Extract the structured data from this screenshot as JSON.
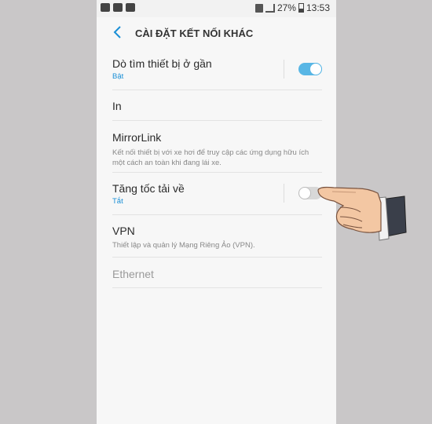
{
  "statusbar": {
    "battery": "27%",
    "time": "13:53"
  },
  "header": {
    "title": "CÀI ĐẶT KẾT NỐI KHÁC"
  },
  "items": [
    {
      "label": "Dò tìm thiết bị ở gần",
      "sub": "Bật",
      "toggle": "on"
    },
    {
      "label": "In"
    },
    {
      "label": "MirrorLink",
      "desc": "Kết nối thiết bị với xe hơi để truy cập các ứng dụng hữu ích một cách an toàn khi đang lái xe."
    },
    {
      "label": "Tăng tốc tải về",
      "sub": "Tắt",
      "toggle": "off"
    },
    {
      "label": "VPN",
      "desc": "Thiết lập và quản lý Mạng Riêng Ảo (VPN)."
    },
    {
      "label": "Ethernet",
      "disabled": true
    }
  ],
  "colors": {
    "accent": "#1a8fd6",
    "toggle_on": "#58b6e5"
  },
  "icons": [
    "back-arrow-icon",
    "pointing-hand-icon"
  ]
}
